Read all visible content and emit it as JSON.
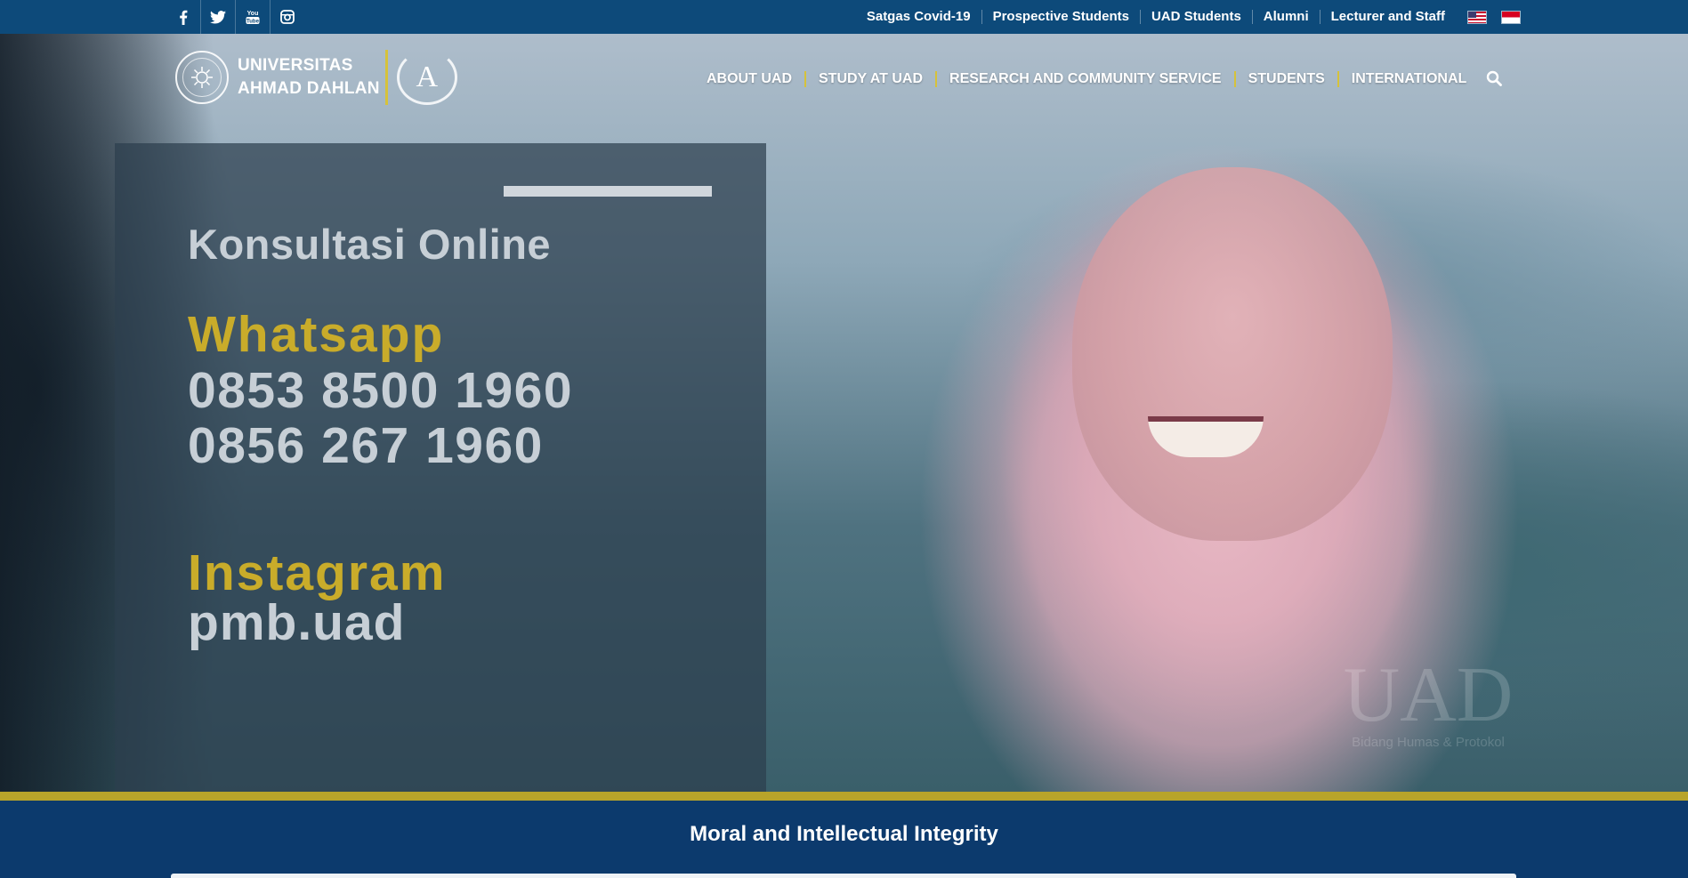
{
  "topbar": {
    "social": [
      {
        "icon": "facebook-icon",
        "glyph": "f"
      },
      {
        "icon": "twitter-icon",
        "glyph": "t"
      },
      {
        "icon": "youtube-icon",
        "glyph": "You"
      },
      {
        "icon": "instagram-icon",
        "glyph": "ig"
      }
    ],
    "links": [
      "Satgas Covid-19",
      "Prospective Students",
      "UAD Students",
      "Alumni",
      "Lecturer and Staff"
    ],
    "flags": [
      "us-flag-icon",
      "indonesia-flag-icon"
    ]
  },
  "logo": {
    "line1": "UNIVERSITAS",
    "line2": "AHMAD DAHLAN",
    "accreditation_letter": "A"
  },
  "nav": {
    "items": [
      "ABOUT UAD",
      "STUDY AT UAD",
      "RESEARCH AND COMMUNITY SERVICE",
      "STUDENTS",
      "INTERNATIONAL"
    ],
    "search_icon": "search-icon"
  },
  "hero": {
    "title": "Konsultasi Online",
    "whatsapp_label": "Whatsapp",
    "phones": [
      "0853 8500 1960",
      "0856 267 1960"
    ],
    "instagram_label": "Instagram",
    "instagram_handle": "pmb.uad",
    "watermark_big": "UAD",
    "watermark_small": "Bidang Humas & Protokol"
  },
  "bottom": {
    "tagline": "Moral and Intellectual Integrity"
  },
  "colors": {
    "topbar": "#0d4a7a",
    "gold": "#c9ac2a",
    "band": "#0c3a6d"
  }
}
